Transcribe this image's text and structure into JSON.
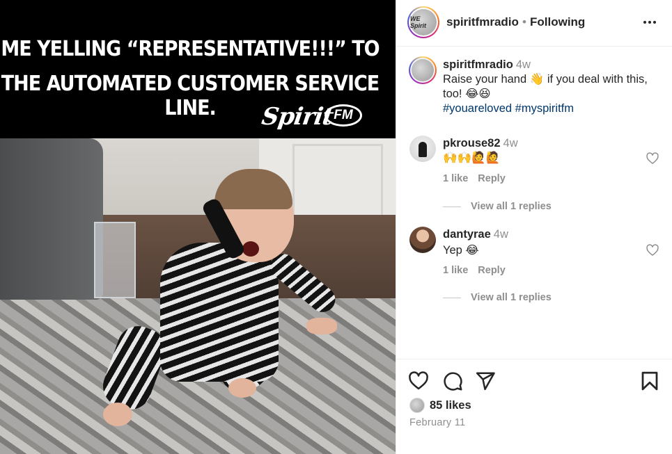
{
  "meme": {
    "line1": "ME YELLING “REPRESENTATIVE!!!” TO",
    "line2": "THE AUTOMATED CUSTOMER SERVICE LINE.",
    "logo_word": "Spirit",
    "logo_fm": "FM"
  },
  "header": {
    "username": "spiritfmradio",
    "separator": "•",
    "follow_status": "Following",
    "avatar_text": "WE Spirit"
  },
  "caption": {
    "username": "spiritfmradio",
    "time": "4w",
    "text": "Raise your hand 👋 if you deal with this, too! 😂😆",
    "hashtags": "#youareloved #myspiritfm"
  },
  "comments": [
    {
      "username": "pkrouse82",
      "time": "4w",
      "text": "🙌🙌🙋🙋",
      "likes": "1 like",
      "reply": "Reply",
      "view_replies": "View all 1 replies"
    },
    {
      "username": "dantyrae",
      "time": "4w",
      "text": "Yep 😂",
      "likes": "1 like",
      "reply": "Reply",
      "view_replies": "View all 1 replies"
    }
  ],
  "footer": {
    "likes": "85 likes",
    "date": "February 11"
  },
  "icons": {
    "like": "heart-icon",
    "comment": "comment-icon",
    "share": "share-icon",
    "save": "bookmark-icon",
    "more": "more-options-icon"
  },
  "colors": {
    "text": "#262626",
    "muted": "#8e8e8e",
    "hashtag": "#00376b",
    "border": "#efefef"
  }
}
